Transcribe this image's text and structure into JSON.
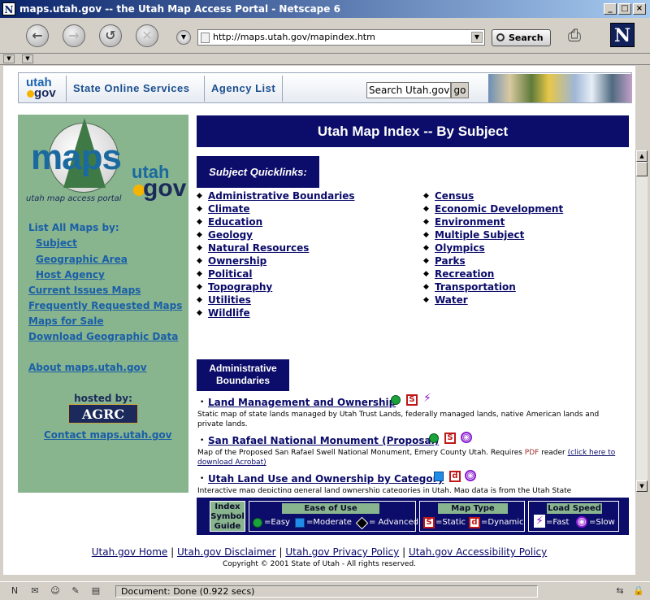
{
  "window": {
    "title": "maps.utah.gov -- the Utah Map Access Portal - Netscape 6",
    "icon_letter": "N"
  },
  "toolbar": {
    "back_icon": "back-arrow-icon",
    "forward_icon": "forward-arrow-icon",
    "reload_icon": "reload-icon",
    "stop_icon": "stop-icon",
    "url": "http://maps.utah.gov/mapindex.htm",
    "search_label": "Search",
    "brand_letter": "N"
  },
  "site_header": {
    "logo_top": "utah",
    "logo_bottom": "gov",
    "nav": [
      "State Online Services",
      "Agency List"
    ],
    "search_placeholder": "Search Utah.gov",
    "go_label": "go"
  },
  "sidebar": {
    "logo_maps": "maps",
    "logo_utah": "utah",
    "logo_gov": "gov",
    "logo_tagline": "utah map access portal",
    "list_all_label": "List All Maps by:",
    "sub_links": [
      "Subject",
      "Geographic Area",
      "Host Agency"
    ],
    "links": [
      "Current Issues Maps",
      "Frequently Requested Maps",
      "Maps for Sale",
      "Download Geographic Data"
    ],
    "about": "About maps.utah.gov",
    "hosted_by": "hosted by:",
    "agrc": "AGRC",
    "contact": "Contact maps.utah.gov"
  },
  "main": {
    "title": "Utah Map Index -- By Subject",
    "quicklinks_title": "Subject Quicklinks:",
    "quicklinks_left": [
      "Administrative Boundaries",
      "Climate",
      "Education",
      "Geology",
      "Natural Resources",
      "Ownership",
      "Political",
      "Topography",
      "Utilities",
      "Wildlife"
    ],
    "quicklinks_right": [
      "Census",
      "Economic Development",
      "Environment",
      "Multiple Subject",
      "Olympics",
      "Parks",
      "Recreation",
      "Transportation",
      "Water"
    ],
    "section_title_1": "Administrative",
    "section_title_2": "Boundaries",
    "items": [
      {
        "title": "Land Management and Ownership",
        "desc": "Static map of state lands managed by Utah Trust Lands, federally managed lands, native American lands and private lands."
      },
      {
        "title": "San Rafael National Monument (Proposal)",
        "desc_a": "Map of the Proposed San Rafael Swell National Monument, Emery County Utah. Requires ",
        "desc_pdf": "PDF",
        "desc_b": " reader ",
        "desc_link": "(click here to download Acrobat)"
      },
      {
        "title": "Utah Land Use and Ownership by Category",
        "desc": "Interactive map depicting general land ownership categories in Utah. Map data is from the Utah State"
      }
    ]
  },
  "legend": {
    "guide_1": "Index",
    "guide_2": "Symbol",
    "guide_3": "Guide",
    "ease_title": "Ease of Use",
    "easy": "=Easy",
    "moderate": "=Moderate",
    "advanced": "= Advanced",
    "type_title": "Map Type",
    "static": "=Static",
    "dynamic": "=Dynamic",
    "static_letter": "S",
    "dynamic_letter": "d",
    "speed_title": "Load Speed",
    "fast": "=Fast",
    "slow": "=Slow",
    "colors": {
      "easy": "#1aa33c",
      "moderate": "#1e8ce8",
      "advanced": "#000000",
      "map_type": "#c01818",
      "speed": "#8a1ad0"
    }
  },
  "footer": {
    "links": [
      "Utah.gov Home",
      "Utah.gov Disclaimer",
      "Utah.gov Privacy Policy",
      "Utah.gov Accessibility Policy"
    ],
    "separator": "|",
    "copyright": "Copyright © 2001 State of Utah - All rights reserved."
  },
  "status": {
    "text": "Document: Done (0.922 secs)"
  }
}
